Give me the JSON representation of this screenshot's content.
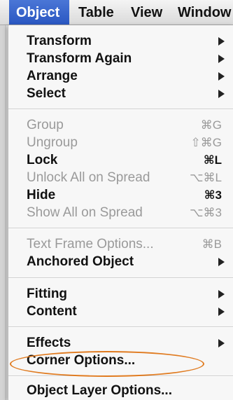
{
  "menubar": {
    "items": [
      {
        "label": "Object"
      },
      {
        "label": "Table"
      },
      {
        "label": "View"
      },
      {
        "label": "Window"
      }
    ]
  },
  "menu": {
    "groups": [
      [
        {
          "label": "Transform",
          "submenu": true
        },
        {
          "label": "Transform Again",
          "submenu": true
        },
        {
          "label": "Arrange",
          "submenu": true
        },
        {
          "label": "Select",
          "submenu": true
        }
      ],
      [
        {
          "label": "Group",
          "shortcut": "⌘G",
          "enabled": false
        },
        {
          "label": "Ungroup",
          "shortcut": "⇧⌘G",
          "enabled": false
        },
        {
          "label": "Lock",
          "shortcut": "⌘L",
          "enabled": true
        },
        {
          "label": "Unlock All on Spread",
          "shortcut": "⌥⌘L",
          "enabled": false
        },
        {
          "label": "Hide",
          "shortcut": "⌘3",
          "enabled": true
        },
        {
          "label": "Show All on Spread",
          "shortcut": "⌥⌘3",
          "enabled": false
        }
      ],
      [
        {
          "label": "Text Frame Options...",
          "shortcut": "⌘B",
          "enabled": false
        },
        {
          "label": "Anchored Object",
          "submenu": true
        }
      ],
      [
        {
          "label": "Fitting",
          "submenu": true
        },
        {
          "label": "Content",
          "submenu": true
        }
      ],
      [
        {
          "label": "Effects",
          "submenu": true
        },
        {
          "label": "Corner Options..."
        }
      ],
      [
        {
          "label": "Object Layer Options...",
          "highlighted": true
        }
      ]
    ]
  },
  "colors": {
    "menubar_active": "#2a57c2",
    "callout": "#e07b20",
    "disabled_text": "#9a9a9a"
  }
}
